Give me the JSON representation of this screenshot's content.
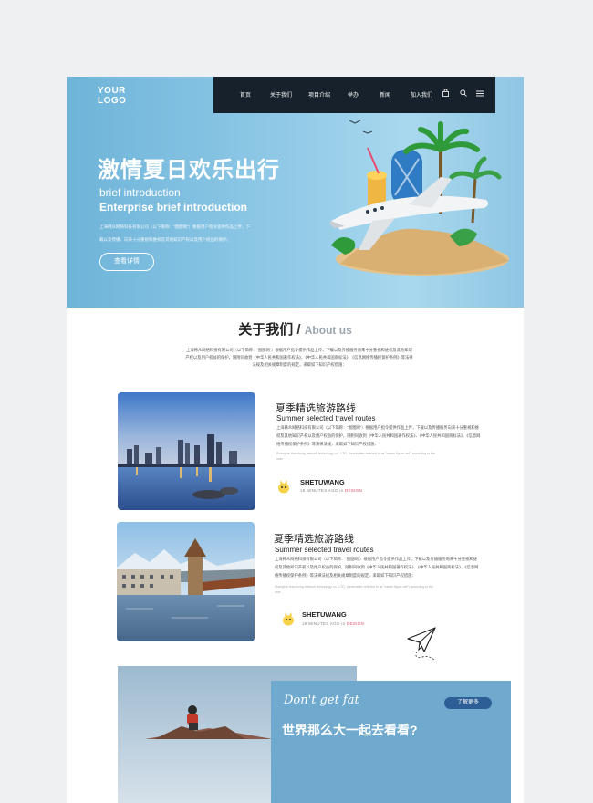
{
  "logo": {
    "line1": "YOUR",
    "line2": "LOGO"
  },
  "nav": {
    "items": [
      "首页",
      "关于我们",
      "项目介绍",
      "举办",
      "新闻",
      "加入我们"
    ],
    "bag_icon": "shopping-bag-icon",
    "search_icon": "search-icon",
    "menu_icon": "menu-icon"
  },
  "hero": {
    "title": "激情夏日欢乐出行",
    "subtitle1": "brief introduction",
    "subtitle2": "Enterprise brief introduction",
    "desc_line1": "上海韩众网络科技有限公司（以下简称：“图图网”）根据用户指令提供作品上传，下",
    "desc_line2": "载以及传播，向来十分重视和维权及其他知识产权以及用户权益的保护。",
    "button": "查看详情"
  },
  "about": {
    "title_cn": "关于我们",
    "separator": "/",
    "title_en": "About us",
    "text": "上海韩众网络科技有限公司（以下简称：“图图网”）根据用户指令提供作品上传，下载以及传播服务向来十分重视和维权及其他知识产权以及用户权益的保护。随附同收到《中华人民共和国著作权法》、《中华人民共和国商标法》、《信息网络传播权保护条例》等法律法规及相关规章制度的规定，采取如下知识产权措施："
  },
  "articles": [
    {
      "title": "夏季精选旅游路线",
      "subtitle": "Summer selected travel routes",
      "body": "上海韩众网络科技有限公司（以下简称：“图图网”）根据用户指令提供作品上传，下载以及传播服务向来十分重视和维权及其他知识产权以及用户权益的保护。随附同收到《中华人民共和国著作权法》、《中华人民共和国商标法》、《信息网络传播权保护条例》等法律法规，采取如下知识产权措施：",
      "small": "Shanghai Hanzhong network technology co., LTD. (hereinafter referred to as \"tuwen figure net\") according to the user",
      "author": "SHETUWANG",
      "meta_time": "19 MINUTES AGO",
      "meta_in": "in",
      "meta_tag": "DESIGN"
    },
    {
      "title": "夏季精选旅游路线",
      "subtitle": "Summer selected travel routes",
      "body": "上海韩众网络科技有限公司（以下简称：“图图网”）根据用户指令提供作品上传，下载以及传播服务向来十分重视和维权及其他知识产权以及用户权益的保护。随附同收到《中华人民共和国著作权法》、《中华人民共和国商标法》、《信息网络传播权保护条例》等法律法规及相关规章制度的规定，采取如下知识产权措施：",
      "small": "Shanghai Hanzhong network technology co., LTD. (hereinafter referred to as \"tuwen figure net\") according to the user",
      "author": "SHETUWANG",
      "meta_time": "19 MINUTES AGO",
      "meta_in": "in",
      "meta_tag": "DESIGN"
    }
  ],
  "bottom": {
    "script": "Don't get fat",
    "title": "世界那么大一起去看看?",
    "button": "了解更多"
  },
  "colors": {
    "hero_blue": "#8ec8e6",
    "nav_dark": "#16212c",
    "card_blue": "#6fa9cd",
    "button_blue": "#2d5f96",
    "tag_pink": "#e04a6a"
  }
}
